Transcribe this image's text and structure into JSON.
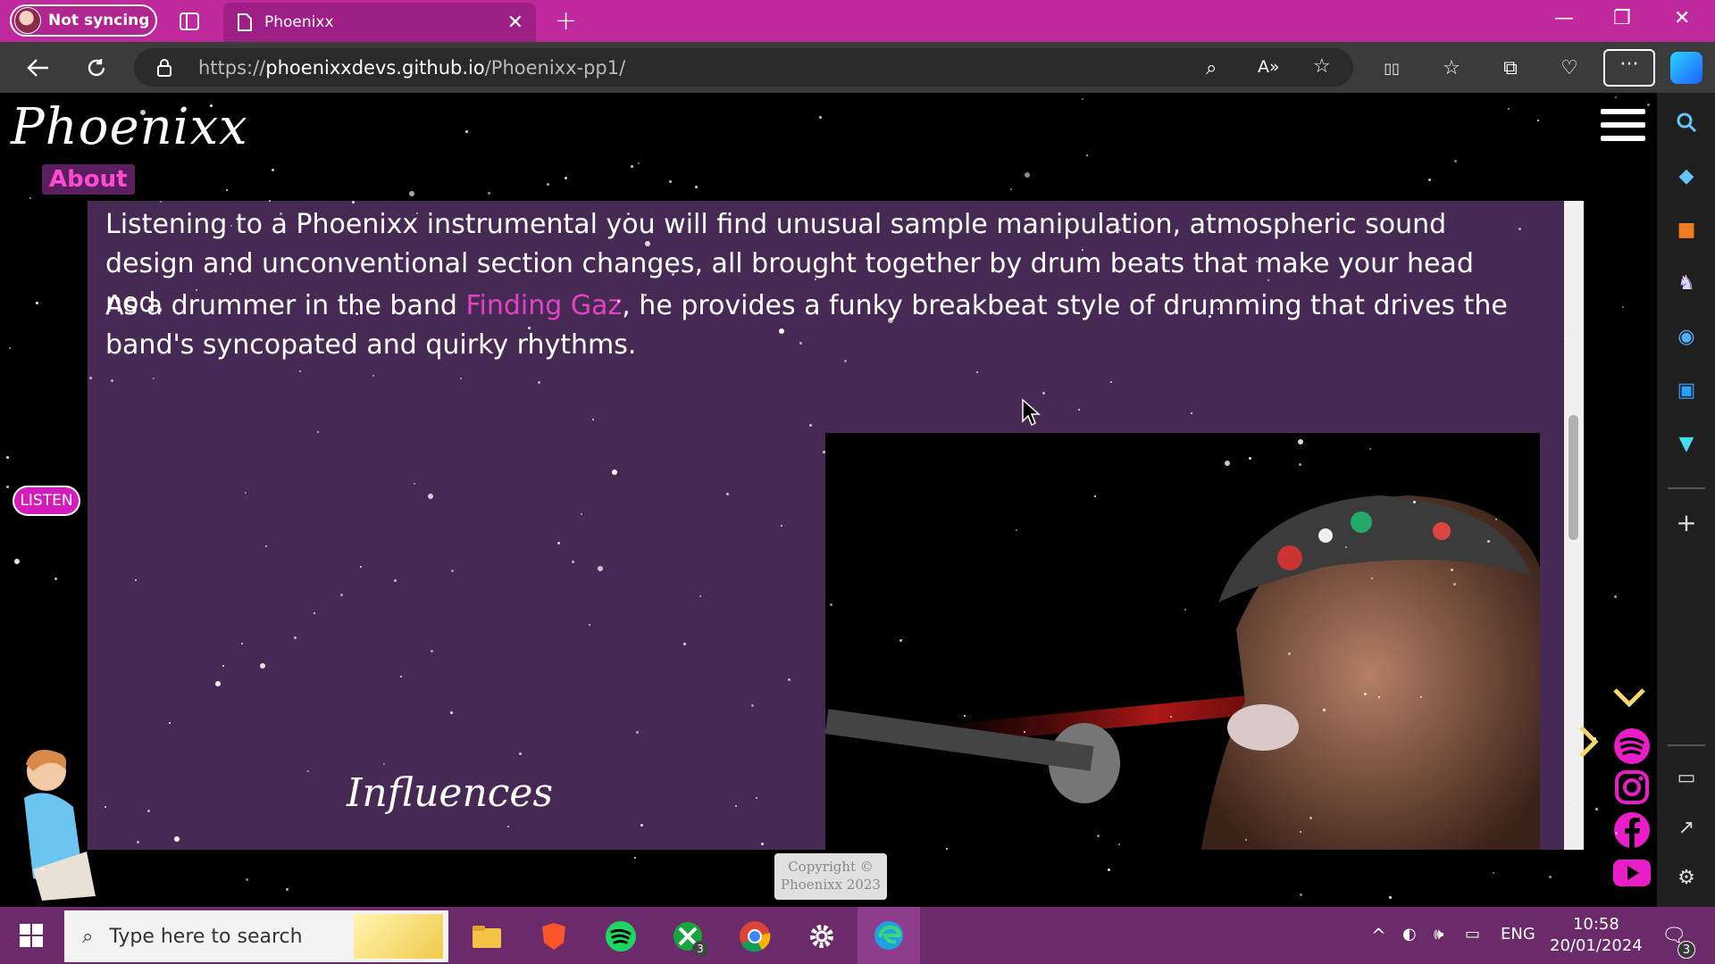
{
  "browser": {
    "profile_label": "Not syncing",
    "tab_title": "Phoenixx",
    "url_prefix": "https://",
    "url_host": "phoenixxdevs.github.io",
    "url_path": "/Phoenixx-pp1/"
  },
  "site": {
    "logo": "Phoenixx",
    "section_badge": "About",
    "paragraph1": "Listening to a Phoenixx instrumental you will find unusual sample manipulation, atmospheric sound design and unconventional section changes, all brought together by drum beats that make your head nod.",
    "paragraph2_before": "As a drummer in the band ",
    "paragraph2_link": "Finding Gaz",
    "paragraph2_after": ", he provides a funky breakbeat style of drumming that drives the band's syncopated and quirky rhythms.",
    "influences_heading": "Influences",
    "listen_button": "LISTEN",
    "copyright": "Copyright © Phoenixx 2023",
    "colors": {
      "accent": "#e442c6",
      "content_bg": "#472a53",
      "titlebar": "#c0299d"
    }
  },
  "taskbar": {
    "search_placeholder": "Type here to search",
    "xbox_badge": "3",
    "language": "ENG",
    "time": "10:58",
    "date": "20/01/2024",
    "notifications": "3"
  }
}
